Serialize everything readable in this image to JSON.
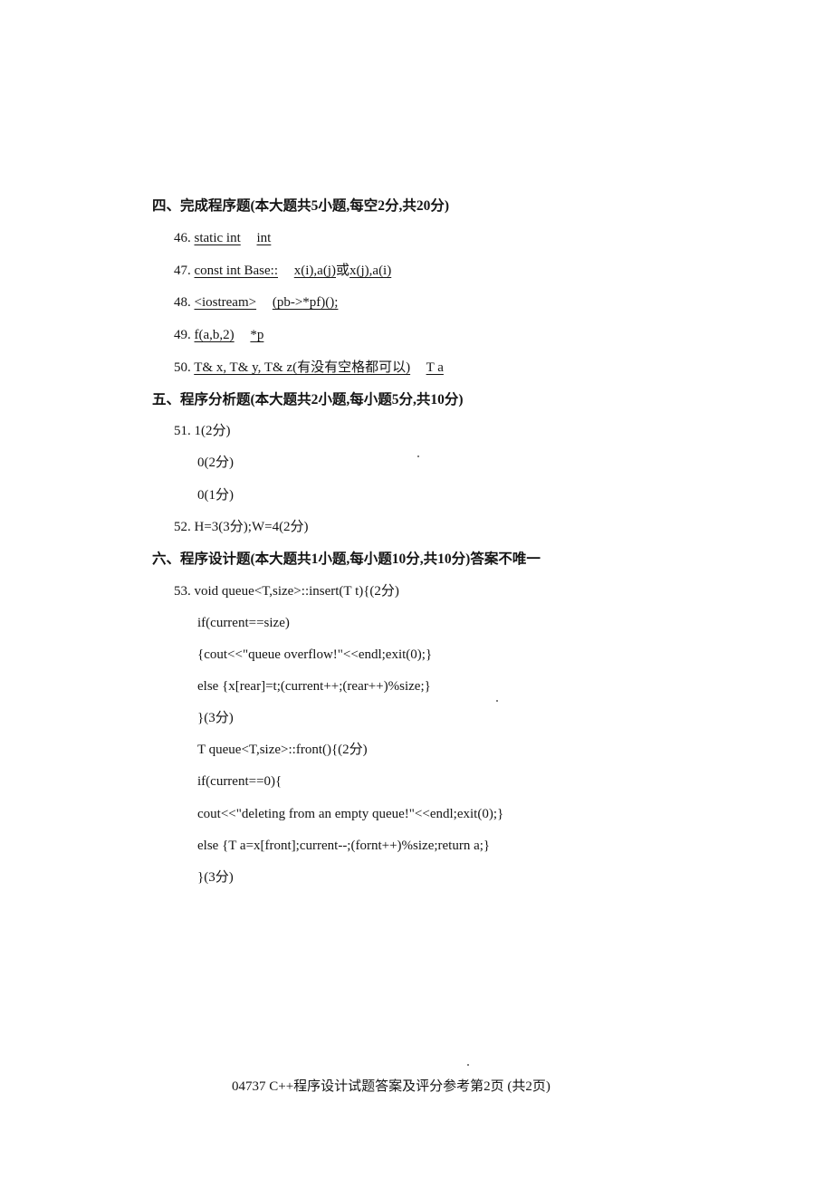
{
  "section4": {
    "heading": "四、完成程序题(本大题共5小题,每空2分,共20分)",
    "items": [
      {
        "num": "46.",
        "blanks": [
          "static int",
          "int"
        ],
        "sep": ""
      },
      {
        "num": "47.",
        "blanks": [
          "const int Base::",
          "x(i),a(j)",
          "x(j),a(i)"
        ],
        "sep": "或"
      },
      {
        "num": "48.",
        "blanks": [
          "<iostream>",
          "(pb->*pf)();"
        ],
        "sep": ""
      },
      {
        "num": "49.",
        "blanks": [
          "f(a,b,2)",
          "*p"
        ],
        "sep": ""
      },
      {
        "num": "50.",
        "blanks": [
          "T& x, T& y, T& z(有没有空格都可以)",
          "T a"
        ],
        "sep": ""
      }
    ]
  },
  "section5": {
    "heading": "五、程序分析题(本大题共2小题,每小题5分,共10分)",
    "lines": [
      "51. 1(2分)",
      "0(2分)",
      "0(1分)",
      "52. H=3(3分);W=4(2分)"
    ]
  },
  "section6": {
    "heading": "六、程序设计题(本大题共1小题,每小题10分,共10分)答案不唯一",
    "first_line": "53. void queue<T,size>::insert(T t){(2分)",
    "code": [
      "if(current==size)",
      "{cout<<\"queue overflow!\"<<endl;exit(0);}",
      "else {x[rear]=t;(current++;(rear++)%size;}",
      "}(3分)",
      "T queue<T,size>::front(){(2分)",
      "if(current==0){",
      "cout<<\"deleting from an empty queue!\"<<endl;exit(0);}",
      "else {T a=x[front];current--;(fornt++)%size;return a;}",
      "}(3分)"
    ]
  },
  "footer": {
    "text": "04737 C++程序设计试题答案及评分参考第2页  (共2页)"
  }
}
